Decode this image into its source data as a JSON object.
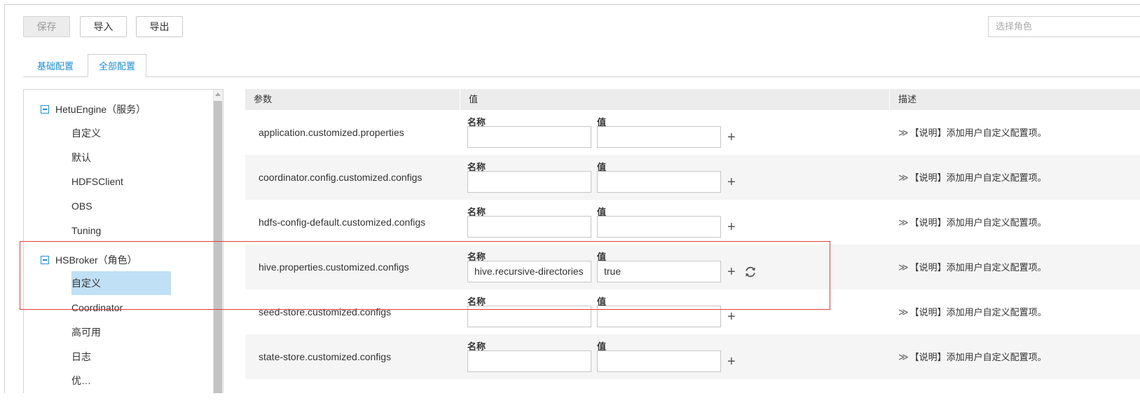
{
  "toolbar": {
    "save_label": "保存",
    "import_label": "导入",
    "export_label": "导出",
    "role_placeholder": "选择角色"
  },
  "tabs": [
    {
      "label": "基础配置",
      "active": false
    },
    {
      "label": "全部配置",
      "active": true
    }
  ],
  "tree": {
    "groups": [
      {
        "label": "HetuEngine（服务）",
        "items": [
          "自定义",
          "默认",
          "HDFSClient",
          "OBS",
          "Tuning"
        ]
      },
      {
        "label": "HSBroker（角色）",
        "items": [
          "自定义",
          "Coordinator",
          "高可用",
          "日志",
          "优…"
        ]
      }
    ],
    "selected_item": "自定义"
  },
  "grid": {
    "headers": {
      "param": "参数",
      "value": "值",
      "desc": "描述"
    },
    "name_label": "名称",
    "value_label": "值",
    "rows": [
      {
        "param": "application.customized.properties",
        "name": "",
        "value": "",
        "desc": "【说明】添加用户自定义配置项。"
      },
      {
        "param": "coordinator.config.customized.configs",
        "name": "",
        "value": "",
        "desc": "【说明】添加用户自定义配置项。"
      },
      {
        "param": "hdfs-config-default.customized.configs",
        "name": "",
        "value": "",
        "desc": "【说明】添加用户自定义配置项。"
      },
      {
        "param": "hive.properties.customized.configs",
        "name": "hive.recursive-directories",
        "value": "true",
        "desc": "【说明】添加用户自定义配置项。"
      },
      {
        "param": "seed-store.customized.configs",
        "name": "",
        "value": "",
        "desc": "【说明】添加用户自定义配置项。"
      },
      {
        "param": "state-store.customized.configs",
        "name": "",
        "value": "",
        "desc": "【说明】添加用户自定义配置项。"
      }
    ],
    "add_symbol": "+",
    "expand_symbol": "≫"
  },
  "colors": {
    "accent": "#1e8fd6",
    "selected_bg": "#bfe0f5",
    "highlight_border": "#e33b3b"
  }
}
